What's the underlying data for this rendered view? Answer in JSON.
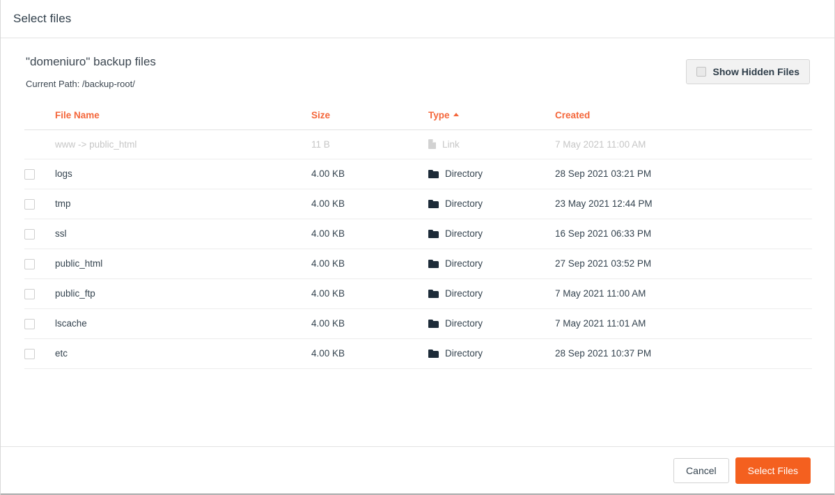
{
  "dialog": {
    "title": "Select files"
  },
  "body": {
    "backup_title": "\"domeniuro\" backup files",
    "current_path": "Current Path: /backup-root/",
    "show_hidden_label": "Show Hidden Files"
  },
  "table": {
    "columns": [
      {
        "key": "name",
        "label": "File Name",
        "sorted": false
      },
      {
        "key": "size",
        "label": "Size",
        "sorted": false
      },
      {
        "key": "type",
        "label": "Type",
        "sorted": true,
        "sort_dir": "asc"
      },
      {
        "key": "created",
        "label": "Created",
        "sorted": false
      }
    ],
    "rows": [
      {
        "name": "www -> public_html",
        "size": "11 B",
        "type": "Link",
        "icon": "file-icon",
        "created": "7 May 2021 11:00 AM",
        "disabled": true,
        "checked": false
      },
      {
        "name": "logs",
        "size": "4.00 KB",
        "type": "Directory",
        "icon": "folder-icon",
        "created": "28 Sep 2021 03:21 PM",
        "disabled": false,
        "checked": false
      },
      {
        "name": "tmp",
        "size": "4.00 KB",
        "type": "Directory",
        "icon": "folder-icon",
        "created": "23 May 2021 12:44 PM",
        "disabled": false,
        "checked": false
      },
      {
        "name": "ssl",
        "size": "4.00 KB",
        "type": "Directory",
        "icon": "folder-icon",
        "created": "16 Sep 2021 06:33 PM",
        "disabled": false,
        "checked": false
      },
      {
        "name": "public_html",
        "size": "4.00 KB",
        "type": "Directory",
        "icon": "folder-icon",
        "created": "27 Sep 2021 03:52 PM",
        "disabled": false,
        "checked": false
      },
      {
        "name": "public_ftp",
        "size": "4.00 KB",
        "type": "Directory",
        "icon": "folder-icon",
        "created": "7 May 2021 11:00 AM",
        "disabled": false,
        "checked": false
      },
      {
        "name": "lscache",
        "size": "4.00 KB",
        "type": "Directory",
        "icon": "folder-icon",
        "created": "7 May 2021 11:01 AM",
        "disabled": false,
        "checked": false
      },
      {
        "name": "etc",
        "size": "4.00 KB",
        "type": "Directory",
        "icon": "folder-icon",
        "created": "28 Sep 2021 10:37 PM",
        "disabled": false,
        "checked": false
      }
    ]
  },
  "footer": {
    "cancel_label": "Cancel",
    "submit_label": "Select Files"
  },
  "colors": {
    "accent": "#f4601f",
    "header_text": "#f4663a",
    "text": "#33424e",
    "icon_dark": "#1d2b38",
    "disabled": "#c6c6c6"
  }
}
